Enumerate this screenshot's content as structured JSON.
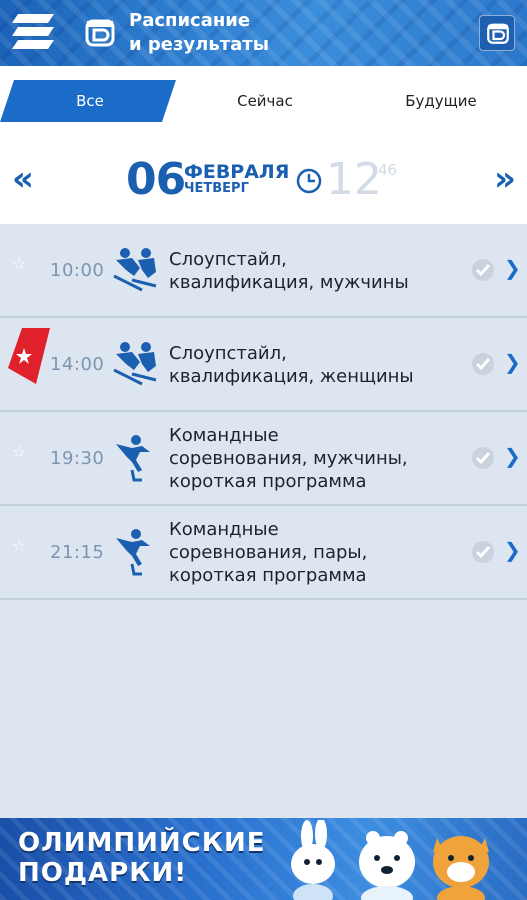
{
  "header": {
    "title_line1": "Расписание",
    "title_line2": "и результаты",
    "menu_icon": "hamburger-menu-icon",
    "logo_icon": "sochi-logo-icon"
  },
  "tabs": [
    {
      "label": "Все",
      "active": true
    },
    {
      "label": "Сейчас",
      "active": false
    },
    {
      "label": "Будущие",
      "active": false
    }
  ],
  "date": {
    "day": "06",
    "month": "ФЕВРАЛЯ",
    "weekday": "ЧЕТВЕРГ",
    "hour": "12",
    "minute": "46",
    "prev_arrow": "«",
    "next_arrow": "»"
  },
  "events": [
    {
      "time": "10:00",
      "sport_icon": "freestyle-ski-icon",
      "line1": "Слоупстайл,",
      "line2": "квалификация, мужчины",
      "line3": "",
      "favorite": false
    },
    {
      "time": "14:00",
      "sport_icon": "freestyle-ski-icon",
      "line1": "Слоупстайл,",
      "line2": "квалификация, женщины",
      "line3": "",
      "favorite": true
    },
    {
      "time": "19:30",
      "sport_icon": "figure-skating-icon",
      "line1": "Командные",
      "line2": "соревнования, мужчины,",
      "line3": "короткая программа",
      "favorite": false
    },
    {
      "time": "21:15",
      "sport_icon": "figure-skating-icon",
      "line1": "Командные",
      "line2": "соревнования, пары,",
      "line3": "короткая программа",
      "favorite": false
    }
  ],
  "banner": {
    "line1": "ОЛИМПИЙСКИЕ",
    "line2": "ПОДАРКИ!"
  },
  "colors": {
    "accent": "#1a5fb0",
    "list_bg": "#dde6f0",
    "favorite_red": "#e0202a"
  }
}
